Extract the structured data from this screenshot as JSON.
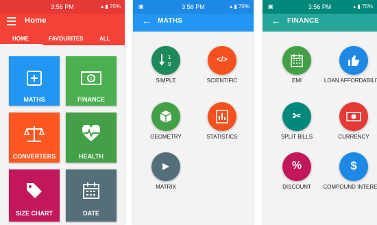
{
  "status": {
    "time": "3:56 PM",
    "battery": "70%"
  },
  "screen1": {
    "title": "Home",
    "tabs": [
      "HOME",
      "FAVOURITES",
      "ALL"
    ],
    "tiles": [
      {
        "label": "MATHS",
        "color": "#2196f3"
      },
      {
        "label": "FINANCE",
        "color": "#4caf50"
      },
      {
        "label": "CONVERTERS",
        "color": "#ff5722"
      },
      {
        "label": "HEALTH",
        "color": "#43a047"
      },
      {
        "label": "SIZE CHART",
        "color": "#c2185b"
      },
      {
        "label": "DATE",
        "color": "#546e7a"
      }
    ]
  },
  "screen2": {
    "title": "MATHS",
    "items": [
      {
        "label": "SIMPLE",
        "icon": "simple-icon",
        "color": "#1e8a5a"
      },
      {
        "label": "SCIENTIFIC",
        "icon": "code-icon",
        "color": "#f4511e"
      },
      {
        "label": "GEOMETRY",
        "icon": "cube-icon",
        "color": "#43a047"
      },
      {
        "label": "STATISTICS",
        "icon": "bar-chart-icon",
        "color": "#f4511e"
      },
      {
        "label": "MATRIX",
        "icon": "play-icon",
        "color": "#546e7a"
      }
    ]
  },
  "screen3": {
    "title": "FINANCE",
    "items": [
      {
        "label": "EMI",
        "icon": "calendar-icon",
        "color": "#43a047"
      },
      {
        "label": "LOAN AFFORDABILITY",
        "icon": "thumbs-up-icon",
        "color": "#1e88e5"
      },
      {
        "label": "SPLIT BILLS",
        "icon": "scissors-icon",
        "color": "#00897b"
      },
      {
        "label": "CURRENCY",
        "icon": "money-icon",
        "color": "#e53935"
      },
      {
        "label": "DISCOUNT",
        "icon": "percent-icon",
        "color": "#c2185b"
      },
      {
        "label": "COMPOUND INTEREST",
        "icon": "dollar-icon",
        "color": "#1e88e5"
      }
    ]
  },
  "colors": {
    "red_bar": "#f44336",
    "red_status": "#e53935",
    "blue_bar": "#2196f3",
    "blue_status": "#1e88e5",
    "teal_bar": "#26a69a",
    "teal_status": "#00897b"
  }
}
